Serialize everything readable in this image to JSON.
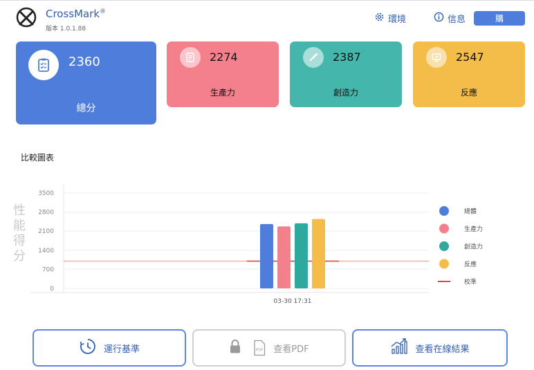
{
  "app": {
    "name": "CrossMark",
    "registered": "®",
    "version": "版本 1.0.1.88"
  },
  "header": {
    "env_label": "環境",
    "info_label": "信息",
    "buy_label": "購"
  },
  "cards": [
    {
      "value": "2360",
      "label": "總分",
      "color": "#4f7ddc"
    },
    {
      "value": "2274",
      "label": "生產力",
      "color": "#f4808c"
    },
    {
      "value": "2387",
      "label": "創造力",
      "color": "#45b6ac"
    },
    {
      "value": "2547",
      "label": "反應",
      "color": "#f3bd47"
    }
  ],
  "chart_title": "比較圖表",
  "chart_data": {
    "type": "bar",
    "ylabel": "性能得分",
    "ylim": [
      0,
      3500
    ],
    "yticks": [
      "3500",
      "2800",
      "2100",
      "1400",
      "700",
      "0"
    ],
    "categories": [
      "03-30 17:31"
    ],
    "series": [
      {
        "name": "總體",
        "values": [
          2360
        ],
        "color": "#4f7ddc"
      },
      {
        "name": "生產力",
        "values": [
          2274
        ],
        "color": "#f4808c"
      },
      {
        "name": "創造力",
        "values": [
          2387
        ],
        "color": "#2fa89d"
      },
      {
        "name": "反應",
        "values": [
          2547
        ],
        "color": "#f3bd47"
      }
    ],
    "reference": {
      "name": "校準",
      "value": 1000,
      "color": "#e04848"
    },
    "grid": true,
    "legend": "right"
  },
  "buttons": {
    "run_label": "運行基準",
    "pdf_label": "查看PDF",
    "pdf_badge": "PDF",
    "online_label": "查看在線結果"
  }
}
